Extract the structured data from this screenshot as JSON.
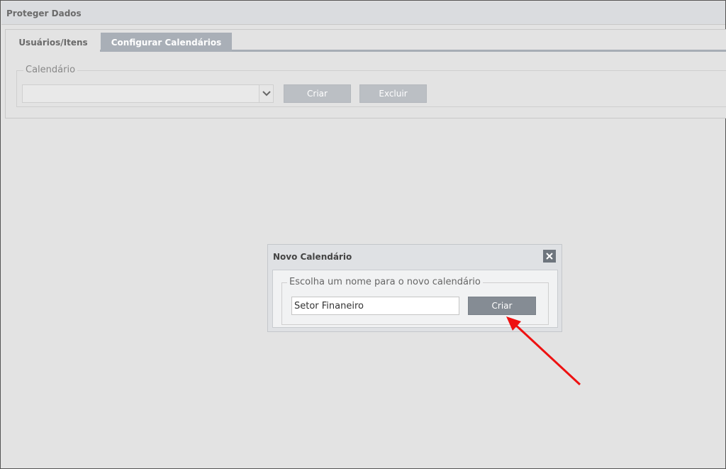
{
  "window": {
    "title": "Proteger Dados"
  },
  "tabs": [
    {
      "label": "Usuários/Itens",
      "active": false
    },
    {
      "label": "Configurar Calendários",
      "active": true
    }
  ],
  "calendar_section": {
    "legend": "Calendário",
    "select_value": "",
    "create_label": "Criar",
    "delete_label": "Excluir"
  },
  "dialog": {
    "title": "Novo Calendário",
    "field_legend": "Escolha um nome para o novo calendário",
    "name_value": "Setor Finaneiro",
    "create_label": "Criar",
    "close_icon": "close-icon"
  },
  "colors": {
    "annotation_arrow": "#ee1111",
    "active_tab": "#a9afb7",
    "primary_button": "#858c94"
  }
}
